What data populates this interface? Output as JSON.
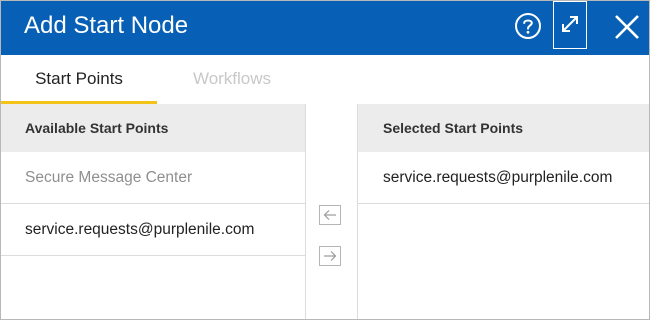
{
  "dialog": {
    "title": "Add Start Node",
    "icons": {
      "help": "help-circle-icon",
      "expand": "expand-icon",
      "close": "close-icon"
    },
    "colors": {
      "titlebar": "#0760b5",
      "tab_indicator": "#f3c317"
    }
  },
  "tabs": [
    {
      "label": "Start Points",
      "active": true
    },
    {
      "label": "Workflows",
      "active": false
    }
  ],
  "available": {
    "header": "Available Start Points",
    "items": [
      {
        "label": "Secure Message Center",
        "disabled": true
      },
      {
        "label": "service.requests@purplenile.com",
        "disabled": false
      }
    ]
  },
  "selected": {
    "header": "Selected Start Points",
    "items": [
      {
        "label": "service.requests@purplenile.com"
      }
    ]
  },
  "transfer": {
    "left_icon": "arrow-left-icon",
    "right_icon": "arrow-right-icon"
  }
}
